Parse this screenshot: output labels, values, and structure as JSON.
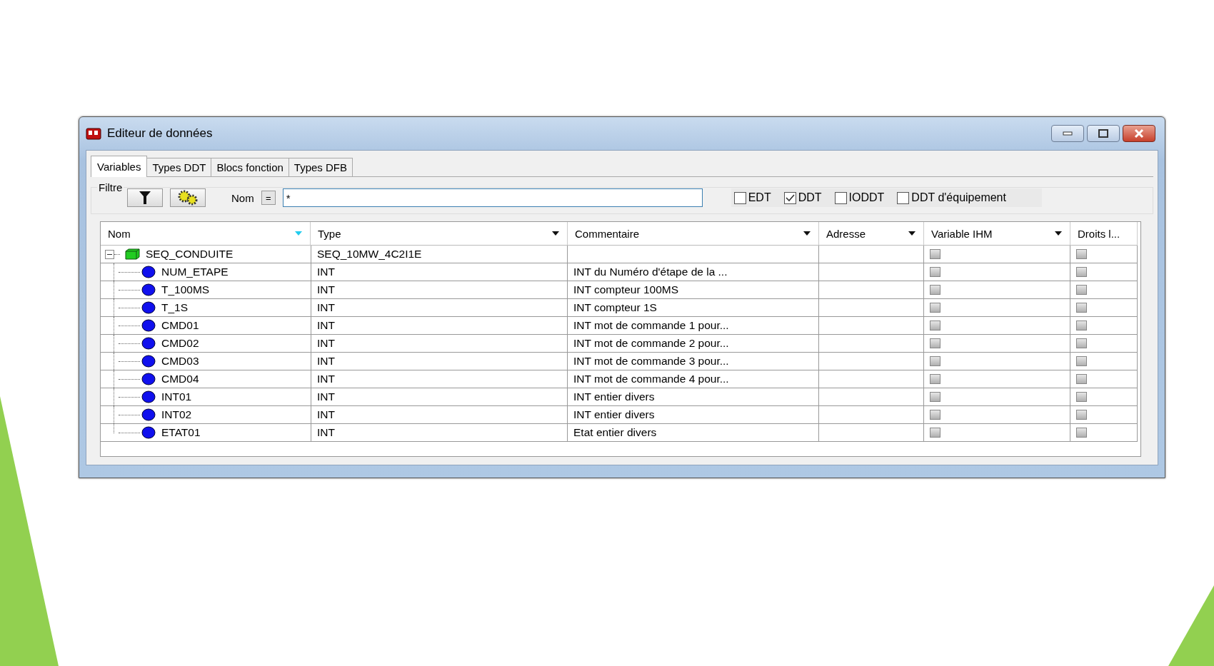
{
  "window": {
    "title": "Editeur de données"
  },
  "tabs": [
    {
      "label": "Variables",
      "selected": true
    },
    {
      "label": "Types DDT",
      "selected": false
    },
    {
      "label": "Blocs fonction",
      "selected": false
    },
    {
      "label": "Types DFB",
      "selected": false
    }
  ],
  "filter": {
    "label": "Filtre",
    "name_label": "Nom",
    "operator": "=",
    "value": "*",
    "options": [
      {
        "label": "EDT",
        "checked": false
      },
      {
        "label": "DDT",
        "checked": true
      },
      {
        "label": "IODDT",
        "checked": false
      },
      {
        "label": "DDT d'équipement",
        "checked": false
      }
    ]
  },
  "table": {
    "columns": [
      {
        "label": "Nom",
        "sorted": true
      },
      {
        "label": "Type",
        "sorted": false
      },
      {
        "label": "Commentaire",
        "sorted": false
      },
      {
        "label": "Adresse",
        "sorted": false
      },
      {
        "label": "Variable IHM",
        "sorted": false
      },
      {
        "label": "Droits l..."
      }
    ],
    "rows": [
      {
        "kind": "structure",
        "name": "SEQ_CONDUITE",
        "type": "SEQ_10MW_4C2I1E",
        "expanded": true,
        "hmi": false,
        "rights": false,
        "children": [
          {
            "kind": "variable",
            "name": "NUM_ETAPE",
            "type": "INT",
            "comment": "INT du Numéro d'étape de la ...",
            "hmi": false,
            "rights": false
          },
          {
            "kind": "variable",
            "name": "T_100MS",
            "type": "INT",
            "comment": "INT compteur 100MS",
            "hmi": false,
            "rights": false
          },
          {
            "kind": "variable",
            "name": "T_1S",
            "type": "INT",
            "comment": "INT compteur 1S",
            "hmi": false,
            "rights": false
          },
          {
            "kind": "variable",
            "name": "CMD01",
            "type": "INT",
            "comment": "INT mot de commande 1 pour...",
            "hmi": false,
            "rights": false
          },
          {
            "kind": "variable",
            "name": "CMD02",
            "type": "INT",
            "comment": "INT mot de commande 2 pour...",
            "hmi": false,
            "rights": false
          },
          {
            "kind": "variable",
            "name": "CMD03",
            "type": "INT",
            "comment": "INT mot de commande 3 pour...",
            "hmi": false,
            "rights": false
          },
          {
            "kind": "variable",
            "name": "CMD04",
            "type": "INT",
            "comment": "INT mot de commande 4 pour...",
            "hmi": false,
            "rights": false
          },
          {
            "kind": "variable",
            "name": "INT01",
            "type": "INT",
            "comment": "INT entier divers",
            "hmi": false,
            "rights": false
          },
          {
            "kind": "variable",
            "name": "INT02",
            "type": "INT",
            "comment": "INT entier divers",
            "hmi": false,
            "rights": false
          },
          {
            "kind": "variable",
            "name": "ETAT01",
            "type": "INT",
            "comment": "Etat entier divers",
            "hmi": false,
            "rights": false
          }
        ]
      }
    ]
  }
}
